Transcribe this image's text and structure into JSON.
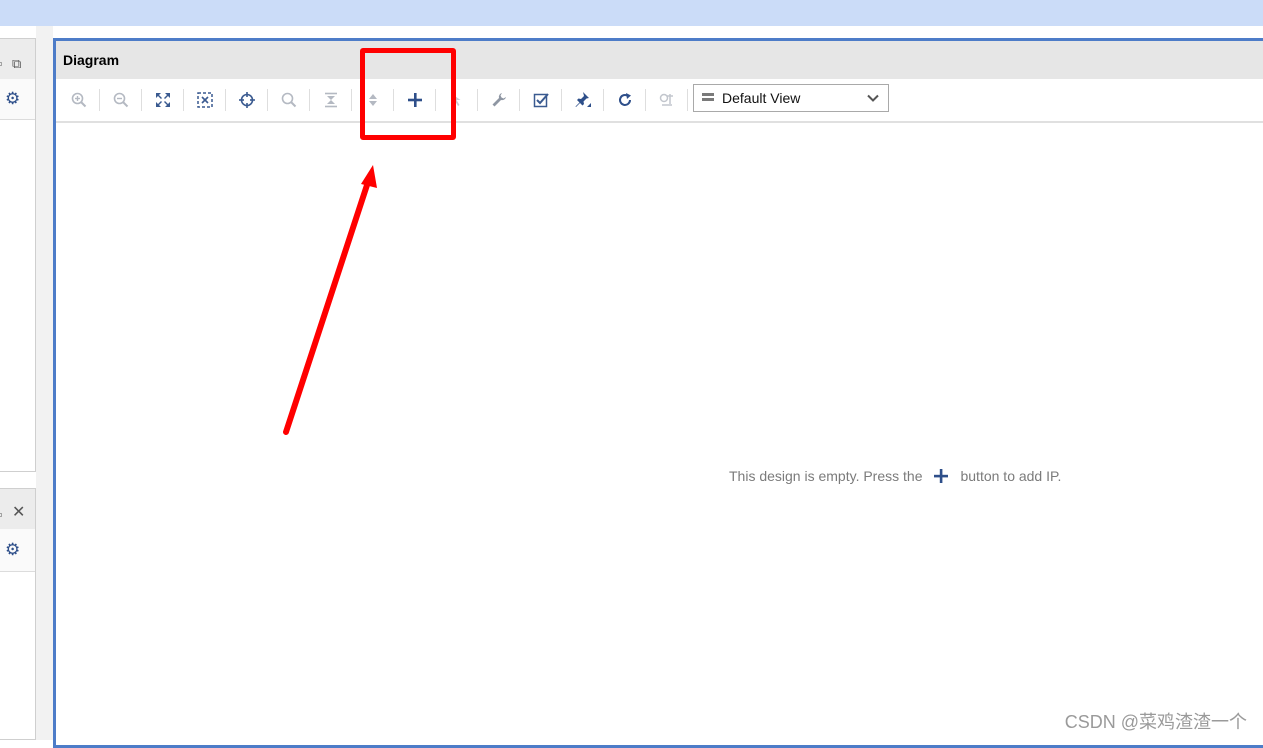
{
  "panel": {
    "title": "Diagram"
  },
  "toolbar": {
    "buttons": [
      {
        "name": "zoom-in-icon",
        "glyph": "⊕",
        "enabled": false
      },
      {
        "name": "zoom-out-icon",
        "glyph": "⊖",
        "enabled": false
      },
      {
        "name": "zoom-fit-icon",
        "glyph": "⛶",
        "enabled": true
      },
      {
        "name": "fit-selection-icon",
        "glyph": "⬚",
        "enabled": true
      },
      {
        "name": "autofit-icon",
        "glyph": "⊹",
        "enabled": true
      },
      {
        "name": "search-icon",
        "glyph": "⚲",
        "enabled": false
      },
      {
        "name": "collapse-all-icon",
        "glyph": "≚",
        "enabled": false
      },
      {
        "name": "expand-all-icon",
        "glyph": "⇳",
        "enabled": false
      },
      {
        "name": "add-ip-icon",
        "glyph": "+",
        "enabled": true
      },
      {
        "name": "select-area-icon",
        "glyph": "↖",
        "enabled": false
      },
      {
        "name": "properties-wrench-icon",
        "glyph": "🔧",
        "enabled": false
      },
      {
        "name": "validate-design-icon",
        "glyph": "☑",
        "enabled": true
      },
      {
        "name": "pin-icon",
        "glyph": "📌",
        "enabled": true
      },
      {
        "name": "regenerate-layout-icon",
        "glyph": "↻",
        "enabled": true
      },
      {
        "name": "run-automation-icon",
        "glyph": "⚙",
        "enabled": false
      }
    ],
    "view_select": "Default View"
  },
  "canvas": {
    "empty_msg_before": "This design is empty. Press the",
    "empty_msg_after": "button to add IP."
  },
  "annotation": {
    "color": "#ff0000"
  },
  "watermark": "CSDN @菜鸡渣渣一个",
  "colors": {
    "accent": "#4d7cc8",
    "icon": "#3a5a90",
    "icon_disabled": "#b4b9c2",
    "top_strip": "#cbdcf8"
  }
}
